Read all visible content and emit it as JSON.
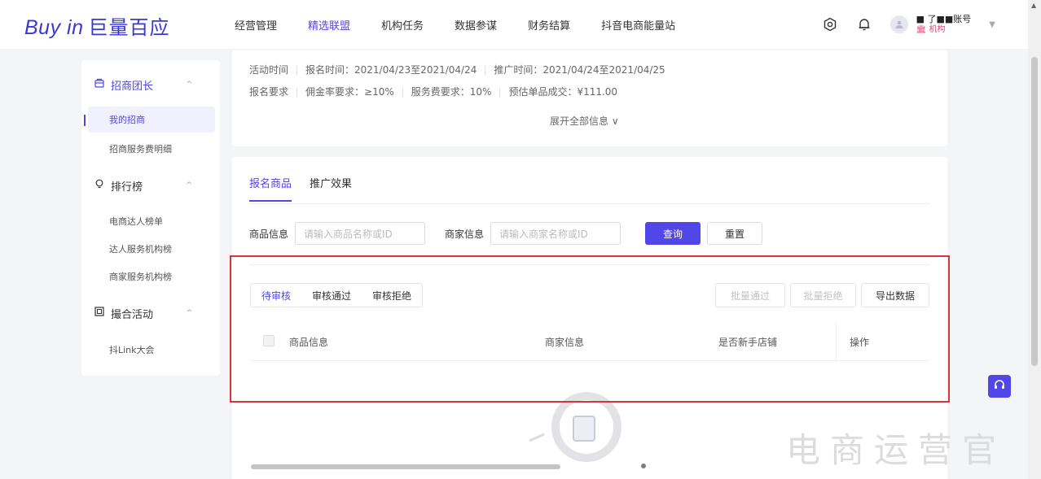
{
  "brand": {
    "logo_en": "Buy in",
    "logo_cn": "巨量百应"
  },
  "nav": {
    "items": [
      "经营管理",
      "精选联盟",
      "机构任务",
      "数据参谋",
      "财务结算",
      "抖音电商能量站"
    ],
    "active_index": 1
  },
  "account": {
    "name": "■ 了■■账号",
    "org": "🏛 机构"
  },
  "sidebar": {
    "groups": [
      {
        "label": "招商团长",
        "icon": "shop-icon",
        "items": [
          "我的招商",
          "招商服务费明细"
        ]
      },
      {
        "label": "排行榜",
        "icon": "bulb-icon",
        "items": [
          "电商达人榜单",
          "达人服务机构榜",
          "商家服务机构榜"
        ]
      },
      {
        "label": "撮合活动",
        "icon": "grid-icon",
        "items": [
          "抖Link大会"
        ]
      }
    ],
    "active_item": "我的招商"
  },
  "activity": {
    "row1": {
      "label": "活动时间",
      "signup": "报名时间：2021/04/23至2021/04/24",
      "promo": "推广时间：2021/04/24至2021/04/25"
    },
    "row2": {
      "label": "报名要求",
      "commission": "佣金率要求：≥10%",
      "service": "服务费要求：10%",
      "deal": "预估单品成交：¥111.00"
    },
    "expand": "展开全部信息 ∨"
  },
  "tabs": {
    "signup_goods": "报名商品",
    "promo_effect": "推广效果"
  },
  "filters": {
    "goods_label": "商品信息",
    "goods_placeholder": "请输入商品名称或ID",
    "merchant_label": "商家信息",
    "merchant_placeholder": "请输入商家名称或ID",
    "query": "查询",
    "reset": "重置"
  },
  "review_tabs": [
    "待审核",
    "审核通过",
    "审核拒绝"
  ],
  "actions": {
    "batch_pass": "批量通过",
    "batch_reject": "批量拒绝",
    "export": "导出数据"
  },
  "table": {
    "columns": [
      "商品信息",
      "商家信息",
      "是否新手店铺",
      "操作"
    ]
  },
  "watermark": "电商运营官",
  "colors": {
    "accent": "#5146e8",
    "highlight_border": "#d9343b"
  }
}
